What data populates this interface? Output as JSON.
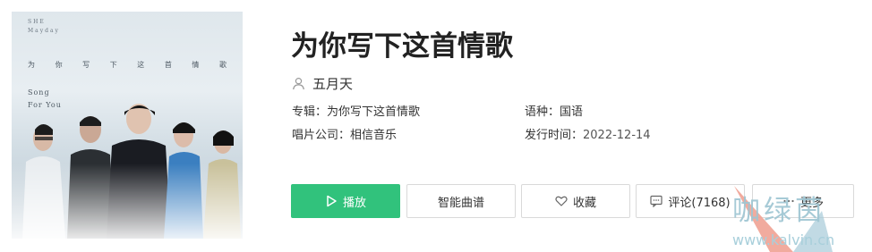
{
  "cover": {
    "top_line_1": "SHE",
    "top_line_2": "Mayday",
    "title_chars": [
      "为",
      "你",
      "写",
      "下",
      "这",
      "首",
      "情",
      "歌"
    ],
    "song_line_1": "Song",
    "song_line_2": "For You"
  },
  "song": {
    "title": "为你写下这首情歌",
    "singer": "五月天"
  },
  "meta": {
    "album_label": "专辑：",
    "album_value": "为你写下这首情歌",
    "language_label": "语种：",
    "language_value": "国语",
    "company_label": "唱片公司：",
    "company_value": "相信音乐",
    "release_label": "发行时间：",
    "release_value": "2022-12-14"
  },
  "actions": {
    "play_label": "播放",
    "sheet_label": "智能曲谱",
    "fav_label": "收藏",
    "comment_label": "评论(7168)",
    "more_label": "更多"
  },
  "watermark": {
    "text": "咖绿茵",
    "url": "www.kalvin.cn"
  },
  "colors": {
    "accent": "#31c27c",
    "border": "#d9d9d9",
    "text": "#333333"
  },
  "icons": [
    "person-icon",
    "play-icon",
    "heart-icon",
    "comment-icon",
    "more-icon"
  ]
}
